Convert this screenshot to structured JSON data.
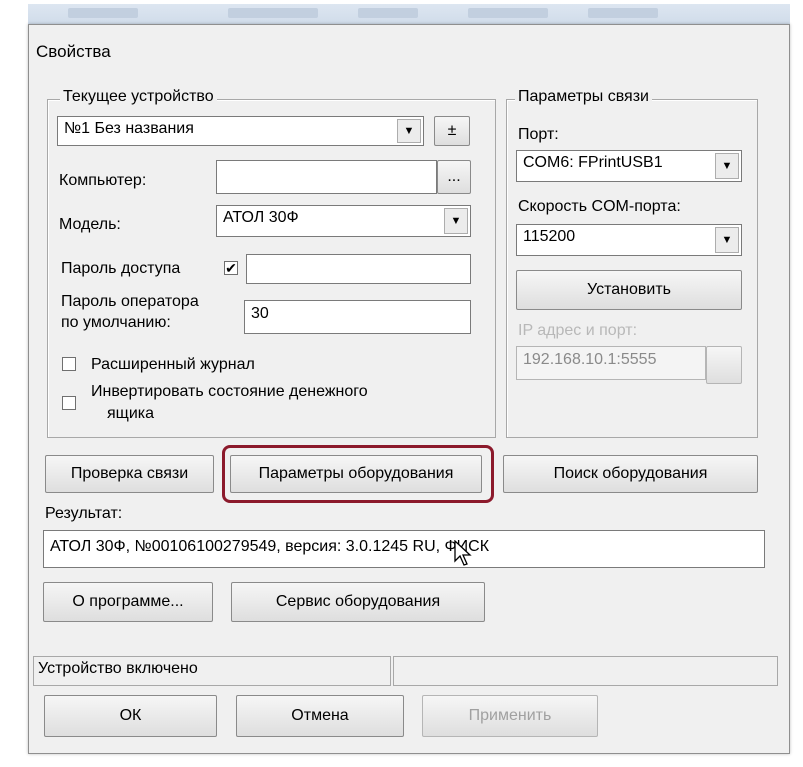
{
  "window": {
    "title": "Свойства"
  },
  "current_device": {
    "group_label": "Текущее устройство",
    "device_value": "№1 Без названия",
    "plusminus_label": "±",
    "computer_label": "Компьютер:",
    "computer_value": "",
    "browse_label": "...",
    "model_label": "Модель:",
    "model_value": "АТОЛ 30Ф",
    "access_password_label": "Пароль доступа",
    "access_password_checked": "✔",
    "access_password_value": "",
    "operator_password_label_1": "Пароль оператора",
    "operator_password_label_2": "по умолчанию:",
    "operator_password_value": "30",
    "extended_log_label": "Расширенный журнал",
    "invert_drawer_label_1": "Инвертировать состояние денежного",
    "invert_drawer_label_2": "ящика"
  },
  "connection": {
    "group_label": "Параметры связи",
    "port_label": "Порт:",
    "port_value": "COM6: FPrintUSB1",
    "baud_label": "Скорость COM-порта:",
    "baud_value": "115200",
    "set_button": "Установить",
    "ip_label": "IP адрес и порт:",
    "ip_value": "192.168.10.1:5555"
  },
  "buttons": {
    "check_connection": "Проверка связи",
    "equipment_params": "Параметры оборудования",
    "search_equipment": "Поиск оборудования",
    "about": "О программе...",
    "equipment_service": "Сервис оборудования",
    "ok": "ОК",
    "cancel": "Отмена",
    "apply": "Применить"
  },
  "result": {
    "label": "Результат:",
    "value": "АТОЛ 30Ф, №00106100279549, версия: 3.0.1245 RU, ФИСК"
  },
  "status": {
    "text": "Устройство включено",
    "text_2": ""
  },
  "colors": {
    "highlight": "#8c1a2c",
    "window_bg": "#f0f0f0"
  }
}
